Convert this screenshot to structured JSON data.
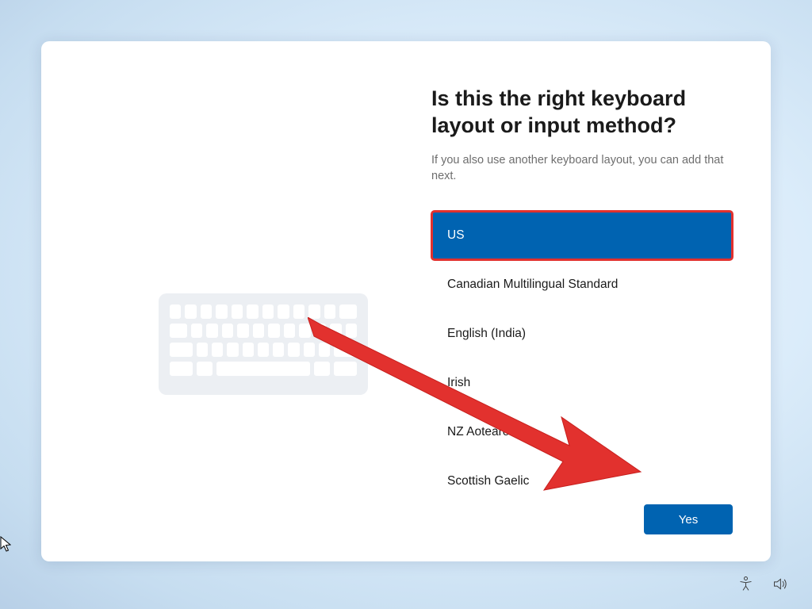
{
  "heading": "Is this the right keyboard layout or input method?",
  "subtext": "If you also use another keyboard layout, you can add that next.",
  "layouts": [
    "US",
    "Canadian Multilingual Standard",
    "English (India)",
    "Irish",
    "NZ Aotearoa",
    "Scottish Gaelic"
  ],
  "selected_index": 0,
  "confirm_label": "Yes"
}
